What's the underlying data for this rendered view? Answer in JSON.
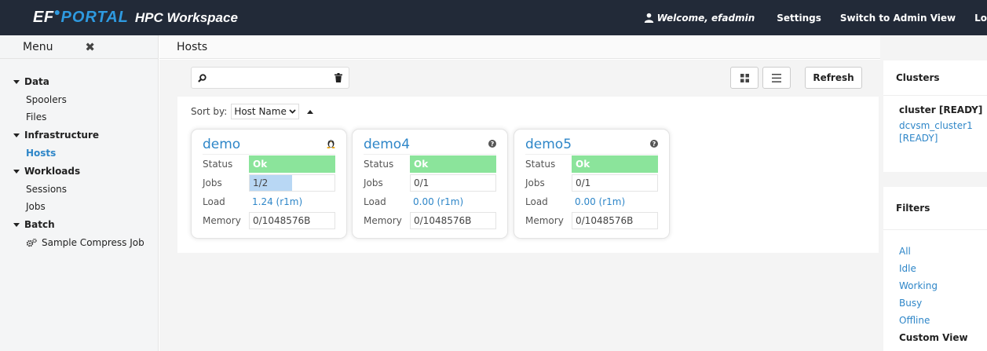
{
  "topbar": {
    "brand_ef": "EF",
    "brand_portal": "PORTAL",
    "brand_product": "HPC Workspace",
    "welcome": "Welcome, efadmin",
    "settings": "Settings",
    "switch_admin": "Switch to Admin View",
    "logout": "Lo"
  },
  "sidebar": {
    "menu_label": "Menu",
    "sections": [
      {
        "label": "Data",
        "items": [
          "Spoolers",
          "Files"
        ]
      },
      {
        "label": "Infrastructure",
        "items": [
          "Hosts"
        ]
      },
      {
        "label": "Workloads",
        "items": [
          "Sessions",
          "Jobs"
        ]
      },
      {
        "label": "Batch",
        "items": [
          "Sample Compress Job"
        ]
      }
    ],
    "active_item": "Hosts"
  },
  "main": {
    "page_title": "Hosts",
    "search": {
      "value": "",
      "placeholder": ""
    },
    "refresh_label": "Refresh",
    "sort_label": "Sort by:",
    "sort_value": "Host Name",
    "hosts": [
      {
        "name": "demo",
        "os_icon": "linux-penguin-icon",
        "status": "Ok",
        "jobs": "1/2",
        "jobs_fraction": 0.5,
        "load": "1.24 (r1m)",
        "memory": "0/1048576B"
      },
      {
        "name": "demo4",
        "os_icon": "help-icon",
        "status": "Ok",
        "jobs": "0/1",
        "jobs_fraction": 0,
        "load": "0.00 (r1m)",
        "memory": "0/1048576B"
      },
      {
        "name": "demo5",
        "os_icon": "help-icon",
        "status": "Ok",
        "jobs": "0/1",
        "jobs_fraction": 0,
        "load": "0.00 (r1m)",
        "memory": "0/1048576B"
      }
    ],
    "labels": {
      "status": "Status",
      "jobs": "Jobs",
      "load": "Load",
      "memory": "Memory"
    }
  },
  "right": {
    "clusters_title": "Clusters",
    "cluster_name": "cluster [READY]",
    "cluster_link": "dcvsm_cluster1 [READY]",
    "filters_title": "Filters",
    "filters": [
      "All",
      "Idle",
      "Working",
      "Busy",
      "Offline",
      "Custom View"
    ]
  },
  "colors": {
    "topbar": "#222a38",
    "accent": "#2e86c8",
    "brand_blue": "#2e9ae0",
    "ok_green": "#8be49b",
    "jobs_fill": "#b8d7f4"
  }
}
